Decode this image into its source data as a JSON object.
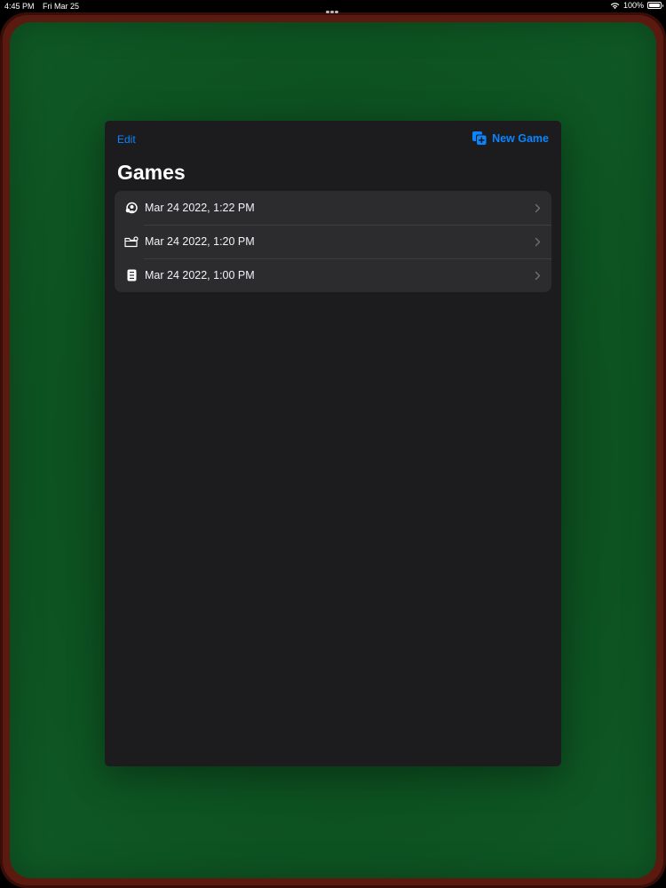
{
  "status_bar": {
    "time": "4:45 PM",
    "date": "Fri Mar 25",
    "battery": "100%"
  },
  "sheet": {
    "edit_label": "Edit",
    "new_game_label": "New Game",
    "title": "Games"
  },
  "games": [
    {
      "label": "Mar 24 2022, 1:22 PM",
      "icon": "spider-solitaire-icon"
    },
    {
      "label": "Mar 24 2022, 1:20 PM",
      "icon": "folder-icon"
    },
    {
      "label": "Mar 24 2022, 1:00 PM",
      "icon": "card-icon"
    }
  ],
  "colors": {
    "accent": "#0a84ff",
    "felt": "#0d5020",
    "rim": "#5a1a10",
    "sheet_bg": "#1c1c1e",
    "list_bg": "#2c2c2e"
  }
}
